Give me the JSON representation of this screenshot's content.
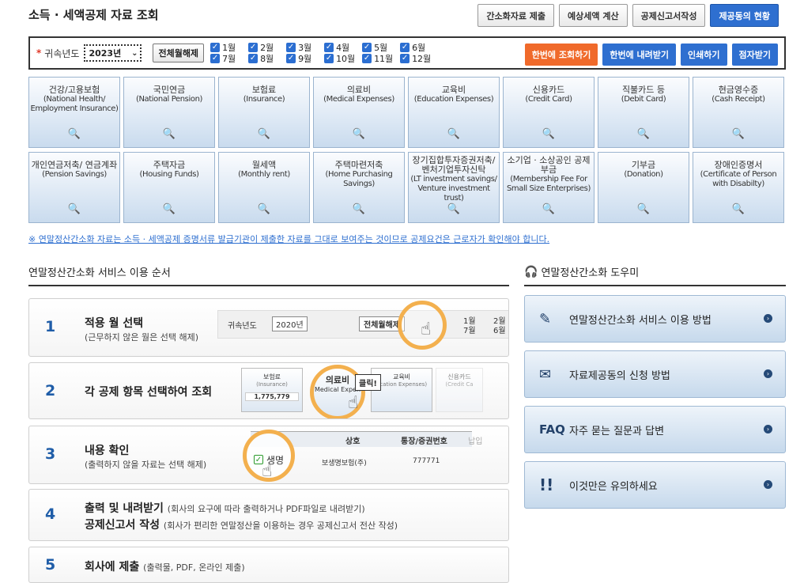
{
  "title": "소득 · 세액공제 자료 조회",
  "top_buttons": [
    "간소화자료 제출",
    "예상세액 계산",
    "공제신고서작성",
    "제공동의 현황"
  ],
  "filter": {
    "required_mark": "*",
    "year_label": "귀속년도",
    "year_value": "2023년",
    "deselect_all": "전체월해제",
    "months_row1": [
      "1월",
      "2월",
      "3월",
      "4월",
      "5월",
      "6월"
    ],
    "months_row2": [
      "7월",
      "8월",
      "9월",
      "10월",
      "11월",
      "12월"
    ],
    "check_glyph": "✓"
  },
  "action_buttons": [
    "한번에 조회하기",
    "한번에 내려받기",
    "인쇄하기",
    "점자받기"
  ],
  "cards": [
    {
      "ko": "건강/고용보험",
      "en": "(National Health/ Employment Insurance)"
    },
    {
      "ko": "국민연금",
      "en": "(National Pension)"
    },
    {
      "ko": "보험료",
      "en": "(Insurance)"
    },
    {
      "ko": "의료비",
      "en": "(Medical Expenses)"
    },
    {
      "ko": "교육비",
      "en": "(Education Expenses)"
    },
    {
      "ko": "신용카드",
      "en": "(Credit Card)"
    },
    {
      "ko": "직불카드 등",
      "en": "(Debit Card)"
    },
    {
      "ko": "현금영수증",
      "en": "(Cash Receipt)"
    },
    {
      "ko": "개인연금저축/ 연금계좌",
      "en": "(Pension Savings)"
    },
    {
      "ko": "주택자금",
      "en": "(Housing Funds)"
    },
    {
      "ko": "월세액",
      "en": "(Monthly rent)"
    },
    {
      "ko": "주택마련저축",
      "en": "(Home Purchasing Savings)"
    },
    {
      "ko": "장기집합투자증권저축/ 벤처기업투자신탁",
      "en": "(LT investment savings/ Venture investment trust)"
    },
    {
      "ko": "소기업 · 소상공인 공제부금",
      "en": "(Membership Fee For Small Size Enterprises)"
    },
    {
      "ko": "기부금",
      "en": "(Donation)"
    },
    {
      "ko": "장애인증명서",
      "en": "(Certificate of Person with Disabilty)"
    }
  ],
  "search_glyph": "🔍",
  "notice": "※ 연말정산간소화 자료는 소득 · 세액공제 증명서류 발급기관이 제출한 자료를 그대로 보여주는 것이므로 공제요건은 근로자가 확인해야 합니다.",
  "steps_title": "연말정산간소화 서비스 이용 순서",
  "steps": [
    {
      "num": "1",
      "title": "적용 월 선택",
      "sub": "(근무하지 않은 월은 선택 해제)"
    },
    {
      "num": "2",
      "title": "각 공제 항목 선택하여 조회",
      "sub": ""
    },
    {
      "num": "3",
      "title": "내용 확인",
      "sub": "(출력하지 않을 자료는 선택 해제)"
    },
    {
      "num": "4",
      "title": "출력 및 내려받기",
      "sub": "(회사의 요구에 따라 출력하거나 PDF파일로 내려받기)",
      "title2": "공제신고서 작성",
      "sub2": "(회사가 편리한 연말정산을 이용하는 경우 공제신고서 전산 작성)"
    },
    {
      "num": "5",
      "title": "회사에 제출",
      "sub": "(출력물, PDF, 온라인 제출)"
    }
  ],
  "step_images": {
    "s1": {
      "year_label": "귀속년도",
      "year": "2020년",
      "btn": "전체월해제",
      "m1": "1월",
      "m2": "2월",
      "m7": "7월",
      "m6": "6월"
    },
    "s2": {
      "c1": "보험료",
      "c1en": "(Insurance)",
      "c1val": "1,775,779",
      "c2": "의료비",
      "c2en": "Medical Expen",
      "click": "클릭!",
      "c3": "교육비",
      "c3en": "ucation Expenses)",
      "c4": "신용카드",
      "c4en": "(Credit Ca"
    },
    "s3": {
      "h1": "상호",
      "h2": "통장/증권번호",
      "h3": "납입",
      "r1": "생명",
      "r1b": "보생명보험(주)",
      "r1c": "777771"
    }
  },
  "helper_title": "연말정산간소화 도우미",
  "helpers": [
    "연말정산간소화 서비스 이용 방법",
    "자료제공동의 신청 방법",
    "자주 묻는 질문과 답변",
    "이것만은 유의하세요"
  ],
  "helper_faq_prefix": "FAQ"
}
